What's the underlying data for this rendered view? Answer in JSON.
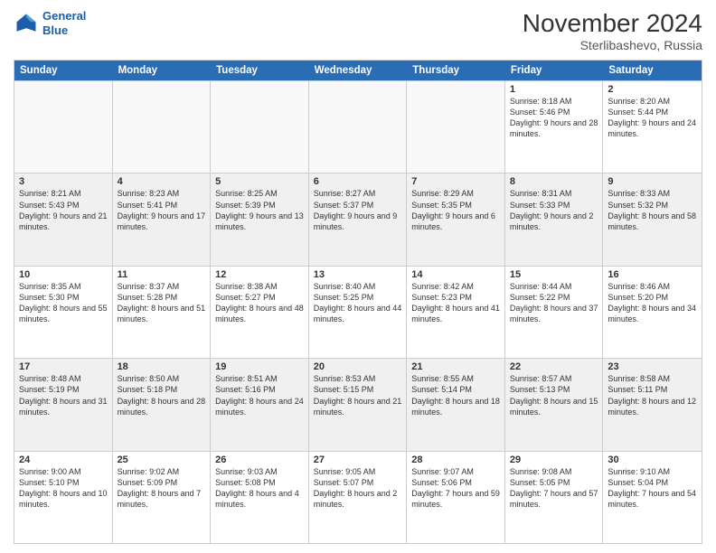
{
  "logo": {
    "line1": "General",
    "line2": "Blue"
  },
  "title": "November 2024",
  "subtitle": "Sterlibashevo, Russia",
  "header": {
    "days": [
      "Sunday",
      "Monday",
      "Tuesday",
      "Wednesday",
      "Thursday",
      "Friday",
      "Saturday"
    ]
  },
  "weeks": [
    [
      {
        "day": "",
        "info": ""
      },
      {
        "day": "",
        "info": ""
      },
      {
        "day": "",
        "info": ""
      },
      {
        "day": "",
        "info": ""
      },
      {
        "day": "",
        "info": ""
      },
      {
        "day": "1",
        "info": "Sunrise: 8:18 AM\nSunset: 5:46 PM\nDaylight: 9 hours\nand 28 minutes."
      },
      {
        "day": "2",
        "info": "Sunrise: 8:20 AM\nSunset: 5:44 PM\nDaylight: 9 hours\nand 24 minutes."
      }
    ],
    [
      {
        "day": "3",
        "info": "Sunrise: 8:21 AM\nSunset: 5:43 PM\nDaylight: 9 hours\nand 21 minutes."
      },
      {
        "day": "4",
        "info": "Sunrise: 8:23 AM\nSunset: 5:41 PM\nDaylight: 9 hours\nand 17 minutes."
      },
      {
        "day": "5",
        "info": "Sunrise: 8:25 AM\nSunset: 5:39 PM\nDaylight: 9 hours\nand 13 minutes."
      },
      {
        "day": "6",
        "info": "Sunrise: 8:27 AM\nSunset: 5:37 PM\nDaylight: 9 hours\nand 9 minutes."
      },
      {
        "day": "7",
        "info": "Sunrise: 8:29 AM\nSunset: 5:35 PM\nDaylight: 9 hours\nand 6 minutes."
      },
      {
        "day": "8",
        "info": "Sunrise: 8:31 AM\nSunset: 5:33 PM\nDaylight: 9 hours\nand 2 minutes."
      },
      {
        "day": "9",
        "info": "Sunrise: 8:33 AM\nSunset: 5:32 PM\nDaylight: 8 hours\nand 58 minutes."
      }
    ],
    [
      {
        "day": "10",
        "info": "Sunrise: 8:35 AM\nSunset: 5:30 PM\nDaylight: 8 hours\nand 55 minutes."
      },
      {
        "day": "11",
        "info": "Sunrise: 8:37 AM\nSunset: 5:28 PM\nDaylight: 8 hours\nand 51 minutes."
      },
      {
        "day": "12",
        "info": "Sunrise: 8:38 AM\nSunset: 5:27 PM\nDaylight: 8 hours\nand 48 minutes."
      },
      {
        "day": "13",
        "info": "Sunrise: 8:40 AM\nSunset: 5:25 PM\nDaylight: 8 hours\nand 44 minutes."
      },
      {
        "day": "14",
        "info": "Sunrise: 8:42 AM\nSunset: 5:23 PM\nDaylight: 8 hours\nand 41 minutes."
      },
      {
        "day": "15",
        "info": "Sunrise: 8:44 AM\nSunset: 5:22 PM\nDaylight: 8 hours\nand 37 minutes."
      },
      {
        "day": "16",
        "info": "Sunrise: 8:46 AM\nSunset: 5:20 PM\nDaylight: 8 hours\nand 34 minutes."
      }
    ],
    [
      {
        "day": "17",
        "info": "Sunrise: 8:48 AM\nSunset: 5:19 PM\nDaylight: 8 hours\nand 31 minutes."
      },
      {
        "day": "18",
        "info": "Sunrise: 8:50 AM\nSunset: 5:18 PM\nDaylight: 8 hours\nand 28 minutes."
      },
      {
        "day": "19",
        "info": "Sunrise: 8:51 AM\nSunset: 5:16 PM\nDaylight: 8 hours\nand 24 minutes."
      },
      {
        "day": "20",
        "info": "Sunrise: 8:53 AM\nSunset: 5:15 PM\nDaylight: 8 hours\nand 21 minutes."
      },
      {
        "day": "21",
        "info": "Sunrise: 8:55 AM\nSunset: 5:14 PM\nDaylight: 8 hours\nand 18 minutes."
      },
      {
        "day": "22",
        "info": "Sunrise: 8:57 AM\nSunset: 5:13 PM\nDaylight: 8 hours\nand 15 minutes."
      },
      {
        "day": "23",
        "info": "Sunrise: 8:58 AM\nSunset: 5:11 PM\nDaylight: 8 hours\nand 12 minutes."
      }
    ],
    [
      {
        "day": "24",
        "info": "Sunrise: 9:00 AM\nSunset: 5:10 PM\nDaylight: 8 hours\nand 10 minutes."
      },
      {
        "day": "25",
        "info": "Sunrise: 9:02 AM\nSunset: 5:09 PM\nDaylight: 8 hours\nand 7 minutes."
      },
      {
        "day": "26",
        "info": "Sunrise: 9:03 AM\nSunset: 5:08 PM\nDaylight: 8 hours\nand 4 minutes."
      },
      {
        "day": "27",
        "info": "Sunrise: 9:05 AM\nSunset: 5:07 PM\nDaylight: 8 hours\nand 2 minutes."
      },
      {
        "day": "28",
        "info": "Sunrise: 9:07 AM\nSunset: 5:06 PM\nDaylight: 7 hours\nand 59 minutes."
      },
      {
        "day": "29",
        "info": "Sunrise: 9:08 AM\nSunset: 5:05 PM\nDaylight: 7 hours\nand 57 minutes."
      },
      {
        "day": "30",
        "info": "Sunrise: 9:10 AM\nSunset: 5:04 PM\nDaylight: 7 hours\nand 54 minutes."
      }
    ]
  ]
}
